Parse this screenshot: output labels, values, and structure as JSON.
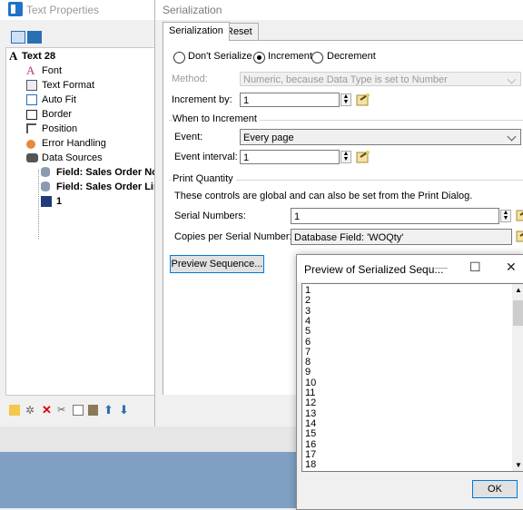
{
  "text_properties": {
    "title": "Text Properties",
    "tree": [
      {
        "label": "Text 28",
        "icon": "text-object-icon",
        "bold": true
      },
      {
        "label": "Font",
        "icon": "font-icon"
      },
      {
        "label": "Text Format",
        "icon": "text-format-icon"
      },
      {
        "label": "Auto Fit",
        "icon": "auto-fit-icon"
      },
      {
        "label": "Border",
        "icon": "border-icon"
      },
      {
        "label": "Position",
        "icon": "position-icon"
      },
      {
        "label": "Error Handling",
        "icon": "error-handling-icon"
      },
      {
        "label": "Data Sources",
        "icon": "data-sources-icon"
      },
      {
        "label": "Field: Sales Order No",
        "icon": "database-field-icon",
        "bold": true
      },
      {
        "label": "Field: Sales Order Line N",
        "icon": "database-field-icon",
        "bold": true
      },
      {
        "label": "1",
        "icon": "serial-number-icon",
        "bold": true
      }
    ]
  },
  "serialization": {
    "title": "Serialization",
    "tabs": [
      "Serialization",
      "Reset"
    ],
    "radios": {
      "dont_serialize": "Don't Serialize",
      "increment": "Increment",
      "decrement": "Decrement",
      "selected": "increment"
    },
    "method_label": "Method:",
    "method_value": "Numeric, because Data Type is set to Number",
    "increment_by_label": "Increment by:",
    "increment_by_value": "1",
    "when_to_increment": {
      "title": "When to Increment",
      "event_label": "Event:",
      "event_value": "Every page",
      "interval_label": "Event interval:",
      "interval_value": "1"
    },
    "print_quantity": {
      "title": "Print Quantity",
      "note": "These controls are global and can also be set from the Print Dialog.",
      "serial_numbers_label": "Serial Numbers:",
      "serial_numbers_value": "1",
      "copies_label": "Copies per Serial Number:",
      "copies_value": "Database Field: 'WOQty'"
    },
    "preview_button": "Preview Sequence..."
  },
  "preview": {
    "title": "Preview of Serialized Sequ...",
    "minimize": "—",
    "maximize": "☐",
    "close": "✕",
    "numbers": [
      "1",
      "2",
      "3",
      "4",
      "5",
      "6",
      "7",
      "8",
      "9",
      "10",
      "11",
      "12",
      "13",
      "14",
      "15",
      "16",
      "17",
      "18"
    ],
    "ok_label": "OK"
  }
}
